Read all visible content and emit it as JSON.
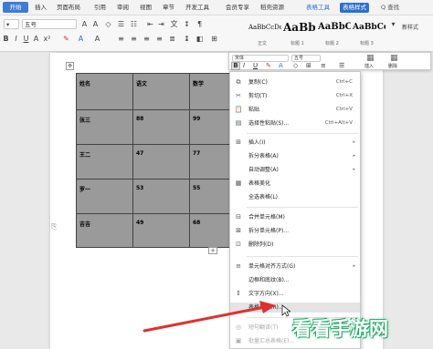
{
  "menubar": {
    "tabs": [
      "开始",
      "插入",
      "页面布局",
      "引用",
      "审阅",
      "视图",
      "章节",
      "开发工具",
      "会员专享",
      "稻壳资源",
      "表格工具",
      "表格样式"
    ],
    "search": "Q 查找"
  },
  "ribbon": {
    "font_name": "五号",
    "font_size": "五号",
    "styles": [
      {
        "sample": "AaBbCcDd",
        "label": "正文"
      },
      {
        "sample": "AaBb",
        "label": "标题 1"
      },
      {
        "sample": "AaBbC",
        "label": "标题 2"
      },
      {
        "sample": "AaBbCc",
        "label": "标题 3"
      }
    ],
    "new_style": "新样式",
    "insert": "插入",
    "delete": "删除"
  },
  "table": {
    "headers": [
      "姓名",
      "语文",
      "数学"
    ],
    "rows": [
      [
        "张三",
        "88",
        "99"
      ],
      [
        "王二",
        "47",
        "77"
      ],
      [
        "罗一",
        "53",
        "55"
      ],
      [
        "吉吉",
        "49",
        "68"
      ]
    ]
  },
  "minibar": {
    "font": "宋体",
    "size": "五号",
    "insert": "插入",
    "delete": "删除"
  },
  "context_menu": {
    "items": [
      {
        "icon": "copy-icon",
        "glyph": "⧉",
        "label": "复制(C)",
        "shortcut": "Ctrl+C"
      },
      {
        "icon": "cut-icon",
        "glyph": "✂",
        "label": "剪切(T)",
        "shortcut": "Ctrl+X"
      },
      {
        "icon": "paste-icon",
        "glyph": "📋",
        "label": "粘贴",
        "shortcut": "Ctrl+V"
      },
      {
        "icon": "paste-special-icon",
        "glyph": "▤",
        "label": "选择性粘贴(S)...",
        "shortcut": "Ctrl+Alt+V"
      },
      {
        "icon": "insert-icon",
        "glyph": "⊞",
        "label": "插入(I)",
        "arrow": true
      },
      {
        "icon": "split-table-icon",
        "glyph": "",
        "label": "拆分表格(A)",
        "arrow": true
      },
      {
        "icon": "autofit-icon",
        "glyph": "",
        "label": "自动调整(A)",
        "arrow": true
      },
      {
        "icon": "table-beautify-icon",
        "glyph": "▦",
        "label": "表格美化"
      },
      {
        "icon": "select-table-icon",
        "glyph": "",
        "label": "全选表格(L)"
      },
      {
        "icon": "merge-cells-icon",
        "glyph": "⊟",
        "label": "合并单元格(M)"
      },
      {
        "icon": "split-cells-icon",
        "glyph": "⊠",
        "label": "拆分单元格(P)..."
      },
      {
        "icon": "delete-column-icon",
        "glyph": "⊡",
        "label": "删除列(D)"
      },
      {
        "icon": "cell-align-icon",
        "glyph": "≡",
        "label": "单元格对齐方式(G)",
        "arrow": true
      },
      {
        "icon": "border-shading-icon",
        "glyph": "",
        "label": "边框和底纹(B)..."
      },
      {
        "icon": "text-direction-icon",
        "glyph": "↕",
        "label": "文字方向(X)..."
      },
      {
        "icon": "table-properties-icon",
        "glyph": "",
        "label": "表格属性(R)..."
      },
      {
        "icon": "short-translate-icon",
        "glyph": "◎",
        "label": "短句翻译(T)"
      },
      {
        "icon": "batch-summary-icon",
        "glyph": "▣",
        "label": "批量汇总表格(E)..."
      }
    ]
  },
  "watermark": "看看手游网",
  "colors": {
    "accent": "#3d7bd7",
    "cell_fill": "#9a9a9a",
    "arrow": "#e03030"
  }
}
